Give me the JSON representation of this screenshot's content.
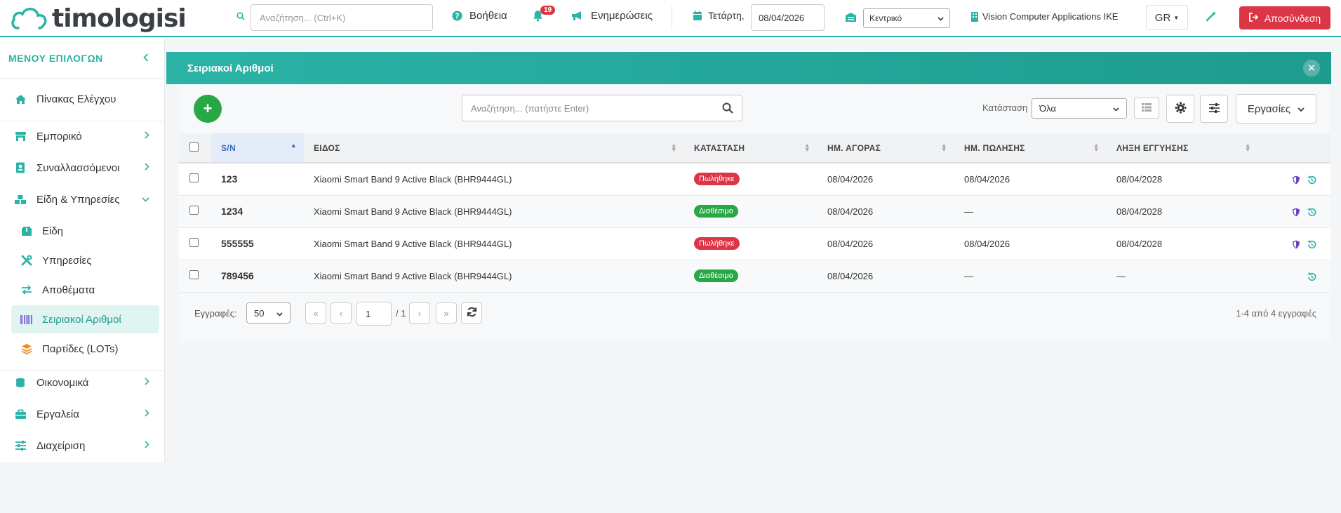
{
  "header": {
    "logo_text": "timologisi",
    "search_placeholder": "Αναζήτηση... (Ctrl+K)",
    "help_label": "Βοήθεια",
    "notifications_count": "19",
    "updates_label": "Ενημερώσεις",
    "day_label": "Τετάρτη,",
    "date_value": "08/04/2026",
    "branch_value": "Κεντρικό",
    "company_name": "Vision Computer Applications IKE",
    "language": "GR",
    "logout_label": "Αποσύνδεση"
  },
  "sidebar": {
    "title": "ΜΕΝΟΥ ΕΠΙΛΟΓΩΝ",
    "items": [
      {
        "label": "Πίνακας Ελέγχου",
        "icon": "home-icon"
      },
      {
        "label": "Εμπορικό",
        "icon": "store-icon"
      },
      {
        "label": "Συναλλασσόμενοι",
        "icon": "contacts-icon"
      },
      {
        "label": "Είδη & Υπηρεσίες",
        "icon": "boxes-icon"
      },
      {
        "label": "Οικονομικά",
        "icon": "coins-icon"
      },
      {
        "label": "Εργαλεία",
        "icon": "toolbox-icon"
      },
      {
        "label": "Διαχείριση",
        "icon": "sliders-icon"
      }
    ],
    "sub_items": [
      {
        "label": "Είδη",
        "icon": "box-icon"
      },
      {
        "label": "Υπηρεσίες",
        "icon": "tools-icon"
      },
      {
        "label": "Αποθέματα",
        "icon": "exchange-icon"
      },
      {
        "label": "Σειριακοί Αριθμοί",
        "icon": "barcode-icon"
      },
      {
        "label": "Παρτίδες (LOTs)",
        "icon": "layers-icon"
      }
    ]
  },
  "panel": {
    "title": "Σειριακοί Αριθμοί",
    "search_placeholder": "Αναζήτηση... (πατήστε Enter)",
    "status_label": "Κατάσταση",
    "status_value": "Όλα",
    "tasks_label": "Εργασίες"
  },
  "table": {
    "headers": [
      "S/N",
      "ΕΙΔΟΣ",
      "ΚΑΤΑΣΤΑΣΗ",
      "ΗΜ. ΑΓΟΡΑΣ",
      "ΗΜ. ΠΩΛΗΣΗΣ",
      "ΛΗΞΗ ΕΓΓΥΗΣΗΣ"
    ],
    "rows": [
      {
        "sn": "123",
        "item": "Xiaomi Smart Band 9 Active Black (BHR9444GL)",
        "status": "Πωλήθηκε",
        "purchase": "08/04/2026",
        "sale": "08/04/2026",
        "warranty": "08/04/2028"
      },
      {
        "sn": "1234",
        "item": "Xiaomi Smart Band 9 Active Black (BHR9444GL)",
        "status": "Διαθέσιμο",
        "purchase": "08/04/2026",
        "sale": "—",
        "warranty": "08/04/2028"
      },
      {
        "sn": "555555",
        "item": "Xiaomi Smart Band 9 Active Black (BHR9444GL)",
        "status": "Πωλήθηκε",
        "purchase": "08/04/2026",
        "sale": "08/04/2026",
        "warranty": "08/04/2028"
      },
      {
        "sn": "789456",
        "item": "Xiaomi Smart Band 9 Active Black (BHR9444GL)",
        "status": "Διαθέσιμο",
        "purchase": "08/04/2026",
        "sale": "—",
        "warranty": "—"
      }
    ]
  },
  "pagination": {
    "per_page_label": "Εγγραφές:",
    "per_page_value": "50",
    "current_page": "1",
    "total_pages": "/ 1",
    "info": "1-4 από 4 εγγραφές"
  },
  "colors": {
    "accent": "#2bb3a6",
    "danger": "#dc3545",
    "success": "#28a745"
  }
}
